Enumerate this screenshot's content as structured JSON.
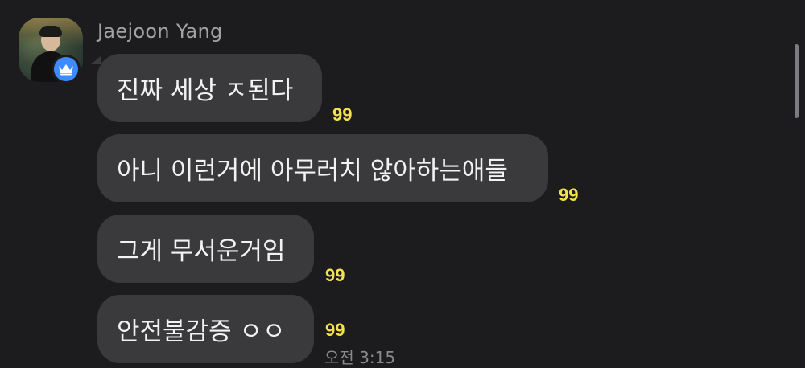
{
  "sender": {
    "name": "Jaejoon Yang",
    "avatar_icon": "profile-photo",
    "badge_icon": "crown-icon",
    "badge_color": "#3d8bff"
  },
  "messages": [
    {
      "text": "진짜 세상 ㅈ된다",
      "count": "99"
    },
    {
      "text": "아니 이런거에 아무러치 않아하는애들",
      "count": "99"
    },
    {
      "text": "그게 무서운거임",
      "count": "99"
    },
    {
      "text": "안전불감증 ㅇㅇ",
      "count": "99",
      "time": "오전 3:15"
    }
  ],
  "colors": {
    "background": "#1c1c1e",
    "bubble": "#3a3a3c",
    "unread_count": "#f5e14a"
  }
}
